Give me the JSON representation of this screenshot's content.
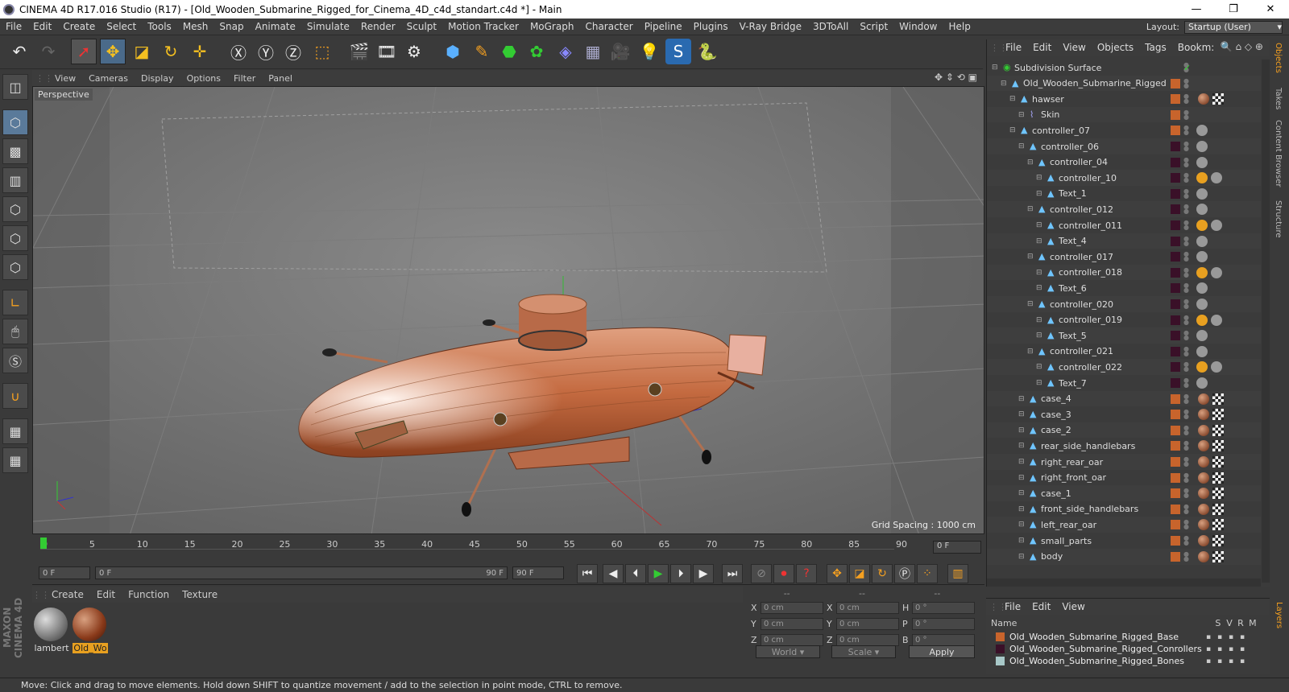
{
  "window": {
    "title": "CINEMA 4D R17.016 Studio (R17) - [Old_Wooden_Submarine_Rigged_for_Cinema_4D_c4d_standart.c4d *] - Main"
  },
  "menubar": [
    "File",
    "Edit",
    "Create",
    "Select",
    "Tools",
    "Mesh",
    "Snap",
    "Animate",
    "Simulate",
    "Render",
    "Sculpt",
    "Motion Tracker",
    "MoGraph",
    "Character",
    "Pipeline",
    "Plugins",
    "V-Ray Bridge",
    "3DToAll",
    "Script",
    "Window",
    "Help"
  ],
  "layout": {
    "label": "Layout:",
    "value": "Startup (User)"
  },
  "viewport": {
    "menu": [
      "View",
      "Cameras",
      "Display",
      "Options",
      "Filter",
      "Panel"
    ],
    "label": "Perspective",
    "grid_spacing": "Grid Spacing : 1000 cm"
  },
  "timeline": {
    "ticks": [
      "0",
      "5",
      "10",
      "15",
      "20",
      "25",
      "30",
      "35",
      "40",
      "45",
      "50",
      "55",
      "60",
      "65",
      "70",
      "75",
      "80",
      "85",
      "90"
    ],
    "frame_field": "0 F"
  },
  "transport": {
    "start": "0 F",
    "range_start": "0 F",
    "range_end": "90 F",
    "end": "90 F"
  },
  "materials": {
    "menu": [
      "Create",
      "Edit",
      "Function",
      "Texture"
    ],
    "items": [
      {
        "name": "lambert"
      },
      {
        "name": "Old_Wo"
      }
    ]
  },
  "coords": {
    "headers": [
      "--",
      "--",
      "--"
    ],
    "rows": [
      {
        "a": "X",
        "av": "0 cm",
        "b": "X",
        "bv": "0 cm",
        "c": "H",
        "cv": "0 °"
      },
      {
        "a": "Y",
        "av": "0 cm",
        "b": "Y",
        "bv": "0 cm",
        "c": "P",
        "cv": "0 °"
      },
      {
        "a": "Z",
        "av": "0 cm",
        "b": "Z",
        "bv": "0 cm",
        "c": "B",
        "cv": "0 °"
      }
    ],
    "world": "World",
    "scale": "Scale",
    "apply": "Apply"
  },
  "objects": {
    "menu": [
      "File",
      "Edit",
      "View",
      "Objects",
      "Tags",
      "Bookm:"
    ],
    "items": [
      {
        "name": "Subdivision Surface",
        "indent": 0,
        "layer": ""
      },
      {
        "name": "Old_Wooden_Submarine_Rigged",
        "indent": 1,
        "layer": "#c8642c"
      },
      {
        "name": "hawser",
        "indent": 2,
        "layer": "#c8642c"
      },
      {
        "name": "Skin",
        "indent": 3,
        "layer": "#c8642c"
      },
      {
        "name": "controller_07",
        "indent": 2,
        "layer": "#c8642c"
      },
      {
        "name": "controller_06",
        "indent": 3,
        "layer": "#3a1028"
      },
      {
        "name": "controller_04",
        "indent": 4,
        "layer": "#3a1028"
      },
      {
        "name": "controller_10",
        "indent": 5,
        "layer": "#3a1028"
      },
      {
        "name": "Text_1",
        "indent": 5,
        "layer": "#3a1028"
      },
      {
        "name": "controller_012",
        "indent": 4,
        "layer": "#3a1028"
      },
      {
        "name": "controller_011",
        "indent": 5,
        "layer": "#3a1028"
      },
      {
        "name": "Text_4",
        "indent": 5,
        "layer": "#3a1028"
      },
      {
        "name": "controller_017",
        "indent": 4,
        "layer": "#3a1028"
      },
      {
        "name": "controller_018",
        "indent": 5,
        "layer": "#3a1028"
      },
      {
        "name": "Text_6",
        "indent": 5,
        "layer": "#3a1028"
      },
      {
        "name": "controller_020",
        "indent": 4,
        "layer": "#3a1028"
      },
      {
        "name": "controller_019",
        "indent": 5,
        "layer": "#3a1028"
      },
      {
        "name": "Text_5",
        "indent": 5,
        "layer": "#3a1028"
      },
      {
        "name": "controller_021",
        "indent": 4,
        "layer": "#3a1028"
      },
      {
        "name": "controller_022",
        "indent": 5,
        "layer": "#3a1028"
      },
      {
        "name": "Text_7",
        "indent": 5,
        "layer": "#3a1028"
      },
      {
        "name": "case_4",
        "indent": 3,
        "layer": "#c8642c"
      },
      {
        "name": "case_3",
        "indent": 3,
        "layer": "#c8642c"
      },
      {
        "name": "case_2",
        "indent": 3,
        "layer": "#c8642c"
      },
      {
        "name": "rear_side_handlebars",
        "indent": 3,
        "layer": "#c8642c"
      },
      {
        "name": "right_rear_oar",
        "indent": 3,
        "layer": "#c8642c"
      },
      {
        "name": "right_front_oar",
        "indent": 3,
        "layer": "#c8642c"
      },
      {
        "name": "case_1",
        "indent": 3,
        "layer": "#c8642c"
      },
      {
        "name": "front_side_handlebars",
        "indent": 3,
        "layer": "#c8642c"
      },
      {
        "name": "left_rear_oar",
        "indent": 3,
        "layer": "#c8642c"
      },
      {
        "name": "small_parts",
        "indent": 3,
        "layer": "#c8642c"
      },
      {
        "name": "body",
        "indent": 3,
        "layer": "#c8642c"
      }
    ]
  },
  "vtabs": [
    "Objects",
    "Takes",
    "Content Browser",
    "Structure"
  ],
  "layers": {
    "menu": [
      "File",
      "Edit",
      "View"
    ],
    "headers": {
      "name": "Name",
      "s": "S",
      "v": "V",
      "r": "R",
      "m": "M"
    },
    "items": [
      {
        "name": "Old_Wooden_Submarine_Rigged_Base",
        "color": "#c8642c"
      },
      {
        "name": "Old_Wooden_Submarine_Rigged_Conrollers",
        "color": "#3a1028"
      },
      {
        "name": "Old_Wooden_Submarine_Rigged_Bones",
        "color": "#a8c8c8"
      }
    ],
    "tab": "Layers"
  },
  "status": "Move: Click and drag to move elements. Hold down SHIFT to quantize movement / add to the selection in point mode, CTRL to remove.",
  "maxon": "MAXON CINEMA 4D"
}
